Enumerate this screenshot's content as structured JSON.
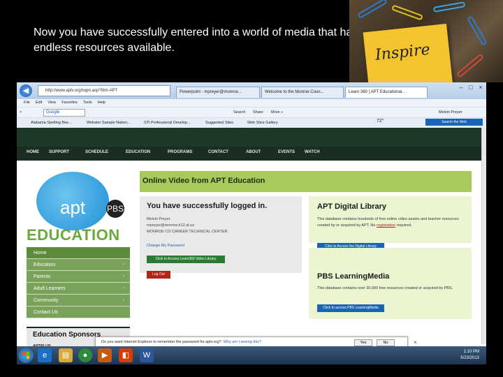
{
  "slide": {
    "title": "Now you have successfully entered into a world of media that has endless resources available.",
    "sticky_note": "Inspire"
  },
  "browser": {
    "address": "http://www.aptv.org/login.asp?fdm-APT",
    "tabs": [
      "Powerpoint - mpreyer@monroe...",
      "Welcome to the Monroe Coun...",
      "Learn 360 | APT Educational..."
    ],
    "menu": [
      "File",
      "Edit",
      "View",
      "Favorites",
      "Tools",
      "Help"
    ],
    "toolbar": {
      "google_label": "Google",
      "items": [
        "Search",
        "Share",
        "More »"
      ],
      "user": "Melvin Preyer"
    },
    "favorites": [
      "Alabama Spelling Bee...",
      "Webster Sample Nation...",
      "STI Professional Develop...",
      "Suggested Sites",
      "Web Slice Gallery"
    ],
    "weather": "72°",
    "search_web": "Search the Web"
  },
  "site": {
    "nav": [
      "HOME",
      "SUPPORT",
      "SCHEDULE",
      "EDUCATION",
      "PROGRAMS",
      "CONTACT",
      "ABOUT",
      "EVENTS",
      "WATCH"
    ],
    "logo_text": "apt",
    "pbs_icon": "PBS",
    "education_word": "EDUCATION",
    "side_menu": [
      {
        "label": "Home",
        "arrow": ""
      },
      {
        "label": "Educators",
        "arrow": "›"
      },
      {
        "label": "Parents",
        "arrow": "›"
      },
      {
        "label": "Adult Learners",
        "arrow": "›"
      },
      {
        "label": "Community",
        "arrow": "›"
      },
      {
        "label": "Contact Us",
        "arrow": ""
      }
    ],
    "sponsor_title": "Education Sponsors",
    "sponsor_name": "APTPLUS",
    "banner": "Online Video from APT Education",
    "logged_in": {
      "heading": "You have successfully logged in.",
      "name": "Melvin Preyer",
      "email": "mpreyer@monroe.k12.al.us",
      "school": "MONROE CO CAREER TECHNICAL CENTER",
      "change_password": "Change My Password",
      "access_button": "Click to Access Learn360 Video Library",
      "logout_button": "Log Out"
    },
    "digital_library": {
      "heading": "APT Digital Library",
      "desc": "This database contains hundreds of free online video assets and teacher resources created by or acquired by APT. No ",
      "desc_link": "registration",
      "desc_end": " required.",
      "button": "Click to Access the Digital Library"
    },
    "pbs_media": {
      "heading": "PBS LearningMedia",
      "desc": "This database contains over 30,000 free resources created or acquired by PBS.",
      "button": "Click to access PBS LearningMedia"
    }
  },
  "notification": {
    "text": "Do you want Internet Explorer to remember the password for aptv.org?",
    "link": "Why am I seeing this?",
    "yes": "Yes",
    "no": "No",
    "close": "×"
  },
  "taskbar": {
    "icons": [
      "ie",
      "folder",
      "chrome",
      "media",
      "office",
      "word"
    ],
    "time": "1:10 PM",
    "date": "5/23/2013"
  }
}
